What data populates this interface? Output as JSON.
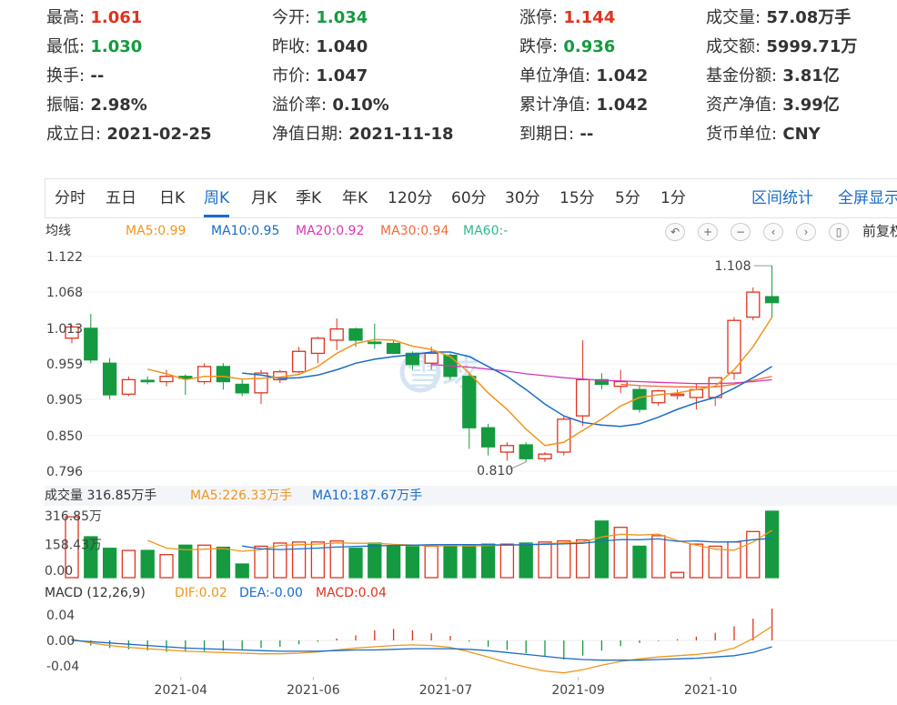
{
  "stats": [
    {
      "label": "最高:",
      "value": "1.061",
      "color": "red"
    },
    {
      "label": "今开:",
      "value": "1.034",
      "color": "green"
    },
    {
      "label": "涨停:",
      "value": "1.144",
      "color": "red"
    },
    {
      "label": "成交量:",
      "value": "57.08万手",
      "color": "dark"
    },
    {
      "label": "最低:",
      "value": "1.030",
      "color": "green"
    },
    {
      "label": "昨收:",
      "value": "1.040",
      "color": "dark"
    },
    {
      "label": "跌停:",
      "value": "0.936",
      "color": "green"
    },
    {
      "label": "成交额:",
      "value": "5999.71万",
      "color": "dark"
    },
    {
      "label": "换手:",
      "value": "--",
      "color": "dark"
    },
    {
      "label": "市价:",
      "value": "1.047",
      "color": "dark"
    },
    {
      "label": "单位净值:",
      "value": "1.042",
      "color": "dark"
    },
    {
      "label": "基金份额:",
      "value": "3.81亿",
      "color": "dark"
    },
    {
      "label": "振幅:",
      "value": "2.98%",
      "color": "dark"
    },
    {
      "label": "溢价率:",
      "value": "0.10%",
      "color": "dark"
    },
    {
      "label": "累计净值:",
      "value": "1.042",
      "color": "dark"
    },
    {
      "label": "资产净值:",
      "value": "3.99亿",
      "color": "dark"
    },
    {
      "label": "成立日:",
      "value": "2021-02-25",
      "color": "dark"
    },
    {
      "label": "净值日期:",
      "value": "2021-11-18",
      "color": "dark"
    },
    {
      "label": "到期日:",
      "value": "--",
      "color": "dark"
    },
    {
      "label": "货币单位:",
      "value": "CNY",
      "color": "dark"
    }
  ],
  "tabs": [
    "分时",
    "五日",
    "日K",
    "周K",
    "月K",
    "季K",
    "年K",
    "120分",
    "60分",
    "30分",
    "15分",
    "5分",
    "1分"
  ],
  "active_tab": "周K",
  "right_tabs": [
    "区间统计",
    "全屏显示"
  ],
  "ma_legend": {
    "title": "均线",
    "items": [
      {
        "text": "MA5:0.99",
        "color": "#f0961e"
      },
      {
        "text": "MA10:0.95",
        "color": "#1a6cc8"
      },
      {
        "text": "MA20:0.92",
        "color": "#d636b8"
      },
      {
        "text": "MA30:0.94",
        "color": "#f06a3c"
      },
      {
        "text": "MA60:-",
        "color": "#30b890"
      }
    ]
  },
  "toolbar": {
    "icons": [
      "undo-icon",
      "zoom-in-icon",
      "zoom-out-icon",
      "pan-left-icon",
      "pan-right-icon",
      "candle-icon"
    ],
    "glyphs": [
      "↶",
      "+",
      "−",
      "‹",
      "›",
      "▯"
    ],
    "fuquan": "前复权"
  },
  "watermark": "雪球",
  "volume_legend": {
    "title": "成交量 316.85万手",
    "ma5": "MA5:226.33万手",
    "ma10": "MA10:187.67万手",
    "ma5_color": "#f0961e",
    "ma10_color": "#1a6cc8"
  },
  "macd_legend": {
    "title": "MACD (12,26,9)",
    "dif": "DIF:0.02",
    "dea": "DEA:-0.00",
    "macd": "MACD:0.04",
    "dif_color": "#f0961e",
    "dea_color": "#1a6cc8",
    "macd_color": "#e0331f"
  },
  "colors": {
    "up": "#e0331f",
    "down": "#159a40"
  },
  "chart_data": [
    {
      "type": "candlestick",
      "price_ticks": [
        "1.122",
        "1.068",
        "1.013",
        "0.959",
        "0.905",
        "0.850",
        "0.796"
      ],
      "ylim": [
        0.796,
        1.122
      ],
      "max_label": "1.108",
      "min_label": "0.810",
      "x_labels": [
        "2021-04",
        "2021-06",
        "2021-07",
        "2021-09",
        "2021-10"
      ],
      "candles": [
        {
          "o": 0.998,
          "h": 1.018,
          "l": 0.99,
          "c": 1.015
        },
        {
          "o": 1.013,
          "h": 1.035,
          "l": 0.96,
          "c": 0.965
        },
        {
          "o": 0.96,
          "h": 0.968,
          "l": 0.905,
          "c": 0.912
        },
        {
          "o": 0.913,
          "h": 0.94,
          "l": 0.91,
          "c": 0.935
        },
        {
          "o": 0.934,
          "h": 0.94,
          "l": 0.928,
          "c": 0.932
        },
        {
          "o": 0.932,
          "h": 0.95,
          "l": 0.925,
          "c": 0.94
        },
        {
          "o": 0.94,
          "h": 0.943,
          "l": 0.912,
          "c": 0.937
        },
        {
          "o": 0.932,
          "h": 0.96,
          "l": 0.928,
          "c": 0.955
        },
        {
          "o": 0.955,
          "h": 0.96,
          "l": 0.92,
          "c": 0.932
        },
        {
          "o": 0.928,
          "h": 0.935,
          "l": 0.91,
          "c": 0.915
        },
        {
          "o": 0.915,
          "h": 0.95,
          "l": 0.898,
          "c": 0.945
        },
        {
          "o": 0.935,
          "h": 0.95,
          "l": 0.93,
          "c": 0.947
        },
        {
          "o": 0.947,
          "h": 0.985,
          "l": 0.945,
          "c": 0.978
        },
        {
          "o": 0.975,
          "h": 1.0,
          "l": 0.96,
          "c": 0.998
        },
        {
          "o": 0.995,
          "h": 1.028,
          "l": 0.98,
          "c": 1.012
        },
        {
          "o": 1.012,
          "h": 1.014,
          "l": 0.985,
          "c": 0.995
        },
        {
          "o": 0.992,
          "h": 1.02,
          "l": 0.982,
          "c": 0.99
        },
        {
          "o": 0.99,
          "h": 0.995,
          "l": 0.975,
          "c": 0.975
        },
        {
          "o": 0.975,
          "h": 0.978,
          "l": 0.95,
          "c": 0.958
        },
        {
          "o": 0.96,
          "h": 0.985,
          "l": 0.95,
          "c": 0.975
        },
        {
          "o": 0.972,
          "h": 0.975,
          "l": 0.935,
          "c": 0.94
        },
        {
          "o": 0.94,
          "h": 0.945,
          "l": 0.83,
          "c": 0.862
        },
        {
          "o": 0.862,
          "h": 0.868,
          "l": 0.82,
          "c": 0.833
        },
        {
          "o": 0.825,
          "h": 0.84,
          "l": 0.812,
          "c": 0.835
        },
        {
          "o": 0.836,
          "h": 0.84,
          "l": 0.81,
          "c": 0.815
        },
        {
          "o": 0.815,
          "h": 0.825,
          "l": 0.81,
          "c": 0.822
        },
        {
          "o": 0.825,
          "h": 0.88,
          "l": 0.82,
          "c": 0.875
        },
        {
          "o": 0.88,
          "h": 0.995,
          "l": 0.865,
          "c": 0.935
        },
        {
          "o": 0.935,
          "h": 0.945,
          "l": 0.92,
          "c": 0.928
        },
        {
          "o": 0.925,
          "h": 0.95,
          "l": 0.915,
          "c": 0.932
        },
        {
          "o": 0.92,
          "h": 0.925,
          "l": 0.885,
          "c": 0.89
        },
        {
          "o": 0.9,
          "h": 0.92,
          "l": 0.895,
          "c": 0.918
        },
        {
          "o": 0.912,
          "h": 0.92,
          "l": 0.905,
          "c": 0.913
        },
        {
          "o": 0.908,
          "h": 0.93,
          "l": 0.89,
          "c": 0.92
        },
        {
          "o": 0.908,
          "h": 0.925,
          "l": 0.895,
          "c": 0.938
        },
        {
          "o": 0.945,
          "h": 1.03,
          "l": 0.935,
          "c": 1.025
        },
        {
          "o": 1.03,
          "h": 1.075,
          "l": 1.025,
          "c": 1.068
        },
        {
          "o": 1.061,
          "h": 1.108,
          "l": 1.03,
          "c": 1.052
        }
      ],
      "ma5": [
        null,
        null,
        null,
        null,
        0.951,
        0.944,
        0.935,
        0.94,
        0.94,
        0.936,
        0.937,
        0.939,
        0.943,
        0.955,
        0.975,
        0.99,
        0.996,
        0.995,
        0.986,
        0.981,
        0.97,
        0.945,
        0.915,
        0.89,
        0.86,
        0.835,
        0.84,
        0.858,
        0.875,
        0.895,
        0.908,
        0.912,
        0.915,
        0.92,
        0.925,
        0.95,
        0.985,
        1.03
      ],
      "ma10": [
        null,
        null,
        null,
        null,
        null,
        null,
        null,
        null,
        null,
        0.945,
        0.942,
        0.937,
        0.938,
        0.942,
        0.95,
        0.96,
        0.966,
        0.97,
        0.973,
        0.977,
        0.977,
        0.97,
        0.955,
        0.94,
        0.92,
        0.898,
        0.88,
        0.87,
        0.866,
        0.864,
        0.868,
        0.878,
        0.89,
        0.9,
        0.908,
        0.922,
        0.938,
        0.955
      ],
      "ma20": [
        null,
        null,
        null,
        null,
        null,
        null,
        null,
        null,
        null,
        null,
        null,
        null,
        null,
        null,
        null,
        null,
        null,
        null,
        null,
        0.958,
        0.956,
        0.954,
        0.951,
        0.948,
        0.944,
        0.941,
        0.938,
        0.936,
        0.934,
        0.933,
        0.932,
        0.931,
        0.93,
        0.929,
        0.929,
        0.93,
        0.932,
        0.935
      ],
      "ma30": [
        null,
        null,
        null,
        null,
        null,
        null,
        null,
        null,
        null,
        null,
        null,
        null,
        null,
        null,
        null,
        null,
        null,
        null,
        null,
        null,
        null,
        null,
        null,
        null,
        null,
        null,
        null,
        null,
        null,
        0.928,
        0.926,
        0.925,
        0.924,
        0.924,
        0.924,
        0.928,
        0.934,
        0.94
      ]
    },
    {
      "type": "bar",
      "title": "成交量",
      "ticks": [
        "316.85万",
        "158.43万",
        "0.00"
      ],
      "ylim": [
        0,
        316.85
      ],
      "values": [
        290,
        195,
        140,
        130,
        130,
        110,
        155,
        155,
        145,
        65,
        150,
        165,
        170,
        170,
        175,
        140,
        165,
        150,
        148,
        150,
        152,
        155,
        160,
        160,
        165,
        170,
        175,
        180,
        270,
        240,
        150,
        200,
        25,
        160,
        150,
        170,
        220,
        316.85
      ],
      "ma5": [
        null,
        null,
        null,
        null,
        178,
        141,
        133,
        136,
        139,
        126,
        134,
        154,
        157,
        160,
        166,
        164,
        164,
        159,
        156,
        151,
        153,
        151,
        153,
        155,
        158,
        162,
        166,
        170,
        194,
        207,
        203,
        208,
        177,
        155,
        136,
        131,
        170,
        226.33
      ],
      "ma10": [
        null,
        null,
        null,
        null,
        null,
        null,
        null,
        null,
        null,
        151,
        137,
        134,
        137,
        141,
        146,
        149,
        151,
        154,
        155,
        157,
        158,
        158,
        157,
        156,
        157,
        159,
        161,
        164,
        174,
        182,
        181,
        185,
        173,
        175,
        170,
        170,
        181,
        187.67
      ]
    },
    {
      "type": "bar",
      "title": "MACD (12,26,9)",
      "ticks": [
        "0.04",
        "0.00",
        "-0.04"
      ],
      "ylim": [
        -0.055,
        0.05
      ],
      "macd": [
        0.002,
        -0.008,
        -0.012,
        -0.014,
        -0.016,
        -0.018,
        -0.018,
        -0.017,
        -0.016,
        -0.014,
        -0.012,
        -0.01,
        -0.006,
        -0.002,
        0.003,
        0.008,
        0.016,
        0.018,
        0.016,
        0.011,
        0.007,
        -0.002,
        -0.01,
        -0.015,
        -0.02,
        -0.025,
        -0.03,
        -0.024,
        -0.016,
        -0.009,
        -0.004,
        -0.001,
        0.002,
        0.006,
        0.012,
        0.022,
        0.034,
        0.05
      ],
      "dif": [
        0.002,
        -0.004,
        -0.008,
        -0.011,
        -0.013,
        -0.015,
        -0.017,
        -0.018,
        -0.019,
        -0.02,
        -0.021,
        -0.021,
        -0.02,
        -0.018,
        -0.015,
        -0.012,
        -0.01,
        -0.008,
        -0.007,
        -0.008,
        -0.011,
        -0.018,
        -0.026,
        -0.035,
        -0.042,
        -0.048,
        -0.051,
        -0.046,
        -0.039,
        -0.033,
        -0.029,
        -0.026,
        -0.024,
        -0.022,
        -0.019,
        -0.012,
        0.003,
        0.022
      ],
      "dea": [
        0.0,
        -0.002,
        -0.004,
        -0.006,
        -0.008,
        -0.01,
        -0.012,
        -0.013,
        -0.014,
        -0.015,
        -0.016,
        -0.017,
        -0.017,
        -0.017,
        -0.016,
        -0.015,
        -0.015,
        -0.014,
        -0.013,
        -0.013,
        -0.013,
        -0.014,
        -0.016,
        -0.019,
        -0.022,
        -0.025,
        -0.028,
        -0.03,
        -0.031,
        -0.031,
        -0.031,
        -0.03,
        -0.029,
        -0.028,
        -0.026,
        -0.024,
        -0.019,
        -0.01
      ]
    }
  ]
}
